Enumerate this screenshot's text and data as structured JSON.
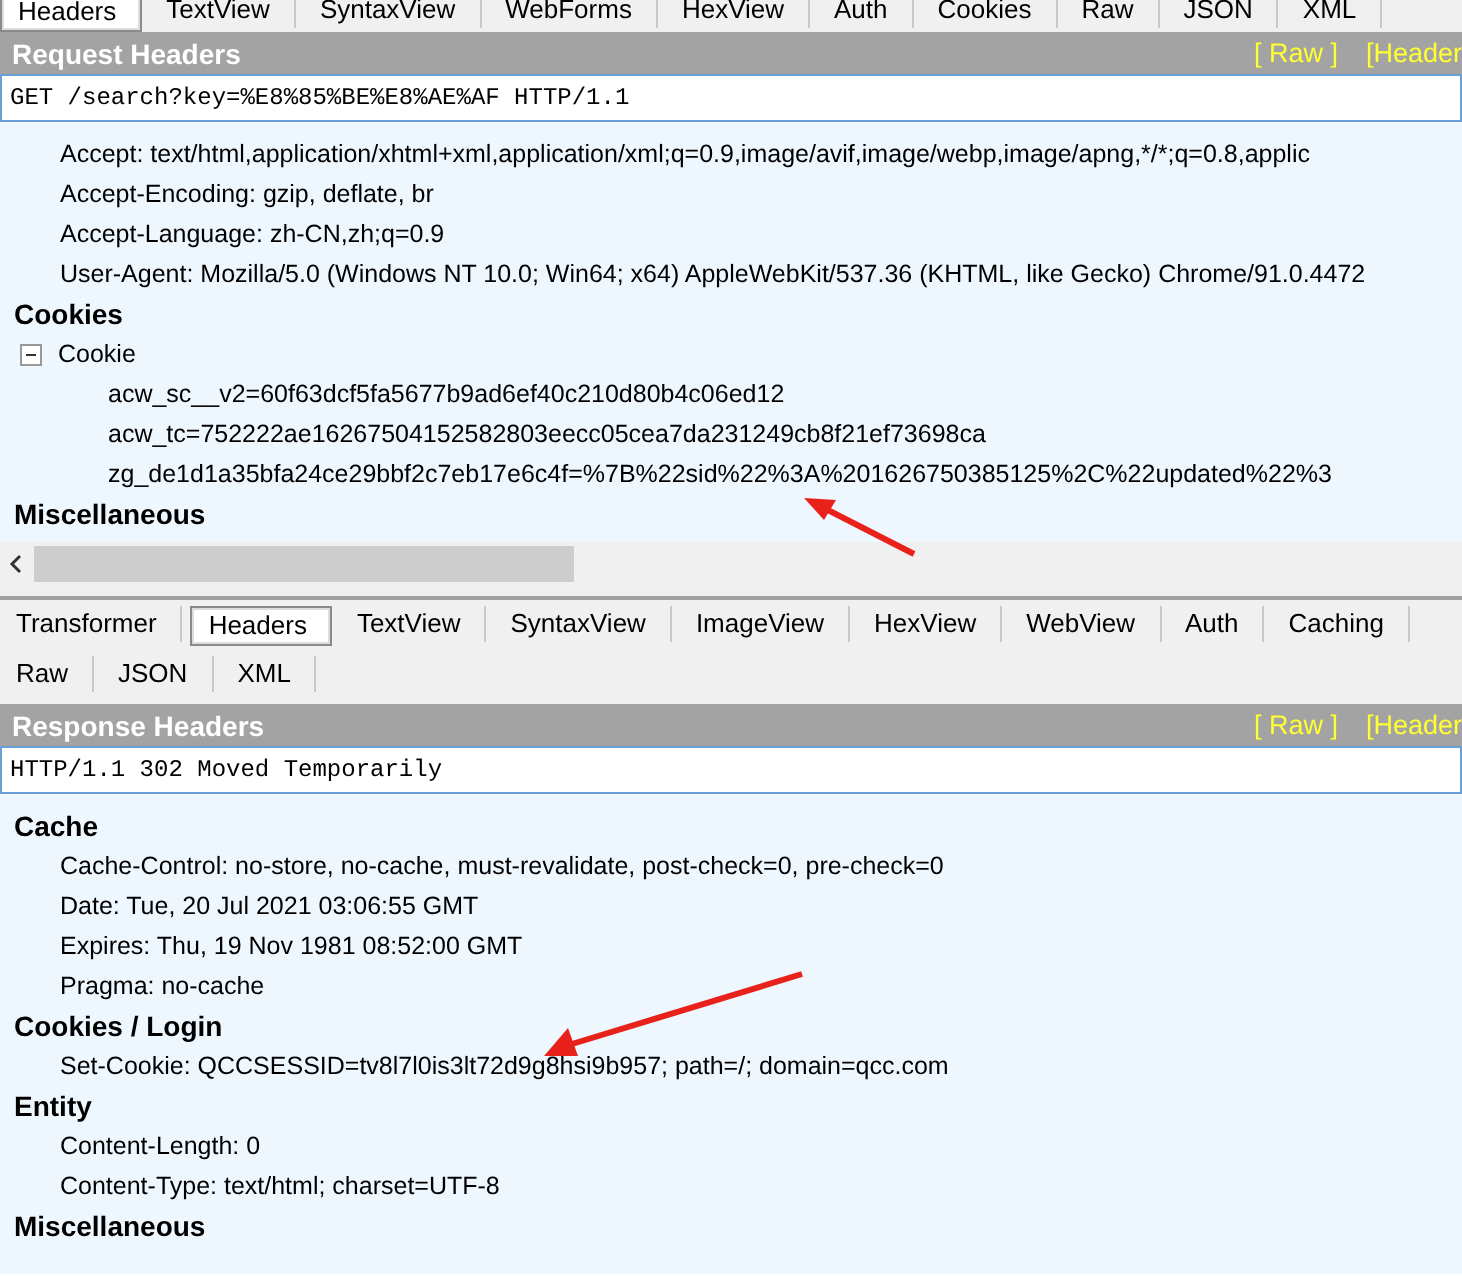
{
  "request_tabs": [
    {
      "label": "Headers",
      "selected": true
    },
    {
      "label": "TextView",
      "selected": false
    },
    {
      "label": "SyntaxView",
      "selected": false
    },
    {
      "label": "WebForms",
      "selected": false
    },
    {
      "label": "HexView",
      "selected": false
    },
    {
      "label": "Auth",
      "selected": false
    },
    {
      "label": "Cookies",
      "selected": false
    },
    {
      "label": "Raw",
      "selected": false
    },
    {
      "label": "JSON",
      "selected": false
    },
    {
      "label": "XML",
      "selected": false
    }
  ],
  "request": {
    "title": "Request Headers",
    "links": [
      "[ Raw ]",
      "[Header"
    ],
    "request_line": "GET /search?key=%E8%85%BE%E8%AE%AF HTTP/1.1",
    "sections": [
      {
        "items": [
          {
            "kind": "line",
            "text": "Accept: text/html,application/xhtml+xml,application/xml;q=0.9,image/avif,image/webp,image/apng,*/*;q=0.8,applic"
          },
          {
            "kind": "line",
            "text": "Accept-Encoding: gzip, deflate, br"
          },
          {
            "kind": "line",
            "text": "Accept-Language: zh-CN,zh;q=0.9"
          },
          {
            "kind": "line",
            "text": "User-Agent: Mozilla/5.0 (Windows NT 10.0; Win64; x64) AppleWebKit/537.36 (KHTML, like Gecko) Chrome/91.0.4472"
          }
        ]
      },
      {
        "title": "Cookies",
        "items": [
          {
            "kind": "tree",
            "text": "Cookie",
            "expanded": true,
            "children": [
              "acw_sc__v2=60f63dcf5fa5677b9ad6ef40c210d80b4c06ed12",
              "acw_tc=752222ae16267504152582803eecc05cea7da231249cb8f21ef73698ca",
              "zg_de1d1a35bfa24ce29bbf2c7eb17e6c4f=%7B%22sid%22%3A%201626750385125%2C%22updated%22%3"
            ]
          }
        ]
      },
      {
        "title": "Miscellaneous"
      }
    ]
  },
  "response_tabs": [
    {
      "label": "Transformer",
      "selected": false
    },
    {
      "label": "Headers",
      "selected": true
    },
    {
      "label": "TextView",
      "selected": false
    },
    {
      "label": "SyntaxView",
      "selected": false
    },
    {
      "label": "ImageView",
      "selected": false
    },
    {
      "label": "HexView",
      "selected": false
    },
    {
      "label": "WebView",
      "selected": false
    },
    {
      "label": "Auth",
      "selected": false
    },
    {
      "label": "Caching",
      "selected": false
    },
    {
      "label": "Raw",
      "selected": false
    },
    {
      "label": "JSON",
      "selected": false
    },
    {
      "label": "XML",
      "selected": false
    }
  ],
  "response": {
    "title": "Response Headers",
    "links": [
      "[ Raw ]",
      "[Header"
    ],
    "status_line": "HTTP/1.1 302 Moved Temporarily",
    "sections": [
      {
        "title": "Cache",
        "items": [
          {
            "kind": "line",
            "text": "Cache-Control: no-store, no-cache, must-revalidate, post-check=0, pre-check=0"
          },
          {
            "kind": "line",
            "text": "Date: Tue, 20 Jul 2021 03:06:55 GMT"
          },
          {
            "kind": "line",
            "text": "Expires: Thu, 19 Nov 1981 08:52:00 GMT"
          },
          {
            "kind": "line",
            "text": "Pragma: no-cache"
          }
        ]
      },
      {
        "title": "Cookies / Login",
        "items": [
          {
            "kind": "line",
            "text": "Set-Cookie: QCCSESSID=tv8l7l0is3lt72d9g8hsi9b957; path=/; domain=qcc.com"
          }
        ]
      },
      {
        "title": "Entity",
        "items": [
          {
            "kind": "line",
            "text": "Content-Length: 0"
          },
          {
            "kind": "line",
            "text": "Content-Type: text/html; charset=UTF-8"
          }
        ]
      },
      {
        "title": "Miscellaneous"
      }
    ]
  }
}
